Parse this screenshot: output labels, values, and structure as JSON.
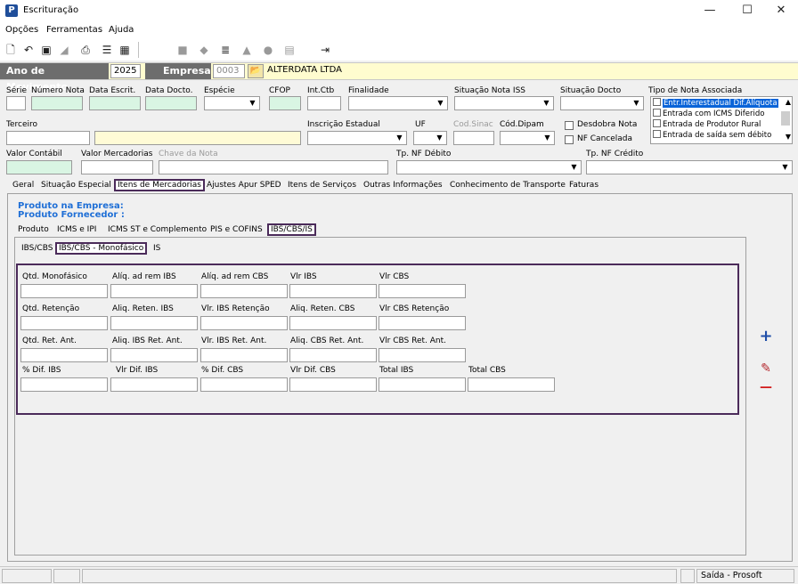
{
  "window": {
    "title": "Escrituração",
    "minimize": "—",
    "maximize": "☐",
    "close": "✕"
  },
  "menu": [
    "Opções",
    "Ferramentas",
    "Ajuda"
  ],
  "toolbar_icons": [
    "new-icon",
    "undo-icon",
    "save-icon",
    "erase-icon",
    "preview-icon",
    "tree-icon",
    "calculator-icon",
    "folder-icon",
    "folder-gear-icon",
    "document-icon",
    "house-icon",
    "people-icon",
    "list-icon",
    "exit-icon"
  ],
  "yearbar": {
    "ano_label": "Ano de Movimento",
    "ano_value": "2025",
    "empresa_label": "Empresa",
    "empresa_code": "0003",
    "empresa_name": "ALTERDATA LTDA"
  },
  "header": {
    "serie": "Série",
    "numero_nota": "Número Nota",
    "data_escrit": "Data Escrit.",
    "data_docto": "Data Docto.",
    "especie": "Espécie",
    "cfop": "CFOP",
    "int_ctb": "Int.Ctb",
    "finalidade": "Finalidade",
    "situacao_nota_iss": "Situação Nota ISS",
    "situacao_docto": "Situação Docto",
    "tipo_nota_associada": "Tipo de Nota Associada",
    "terceiro": "Terceiro",
    "inscricao_estadual": "Inscrição Estadual",
    "uf": "UF",
    "cod_sinac": "Cod.Sinac",
    "cod_dipam": "Cód.Dipam",
    "desdobra_nota": "Desdobra Nota",
    "nf_cancelada": "NF Cancelada",
    "valor_contabil": "Valor Contábil",
    "valor_mercadorias": "Valor Mercadorias",
    "chave_nota": "Chave da Nota",
    "tp_nf_debito": "Tp. NF Débito",
    "tp_nf_credito": "Tp. NF Crédito"
  },
  "tipo_nota_list": [
    "Entr.Interestadual Dif.Alíquota",
    "Entrada com ICMS Diferido",
    "Entrada de Produtor Rural",
    "Entrada de saída sem débito"
  ],
  "main_tabs": [
    "Geral",
    "Situação Especial",
    "Itens de Mercadorias",
    "Ajustes Apur SPED",
    "Itens de Serviços",
    "Outras Informações",
    "Conhecimento de Transporte",
    "Faturas"
  ],
  "produto": {
    "empresa": "Produto na Empresa:",
    "fornecedor": "Produto Fornecedor :"
  },
  "sub_tabs": [
    "Produto",
    "ICMS e IPI",
    "ICMS ST e Complemento",
    "PIS e COFINS",
    "IBS/CBS/IS"
  ],
  "sub_sub_tabs": [
    "IBS/CBS",
    "IBS/CBS - Monofásico",
    "IS"
  ],
  "fields": [
    [
      "Qtd. Monofásico",
      "Alíq. ad rem IBS",
      "Alíq. ad rem CBS",
      "Vlr IBS",
      "Vlr CBS"
    ],
    [
      "Qtd. Retenção",
      "Aliq. Reten. IBS",
      "Vlr. IBS Retenção",
      "Aliq. Reten. CBS",
      "Vlr CBS Retenção"
    ],
    [
      "Qtd. Ret. Ant.",
      "Aliq. IBS Ret. Ant.",
      "Vlr. IBS Ret. Ant.",
      "Aliq. CBS Ret. Ant.",
      "Vlr CBS Ret. Ant."
    ],
    [
      "% Dif. IBS",
      "Vlr Dif. IBS",
      "% Dif. CBS",
      "Vlr Dif. CBS",
      "Total IBS",
      "Total CBS"
    ]
  ],
  "side_buttons": {
    "add": "+",
    "edit": "✎",
    "remove": "—"
  },
  "status": {
    "right": "Saída - Prosoft"
  }
}
